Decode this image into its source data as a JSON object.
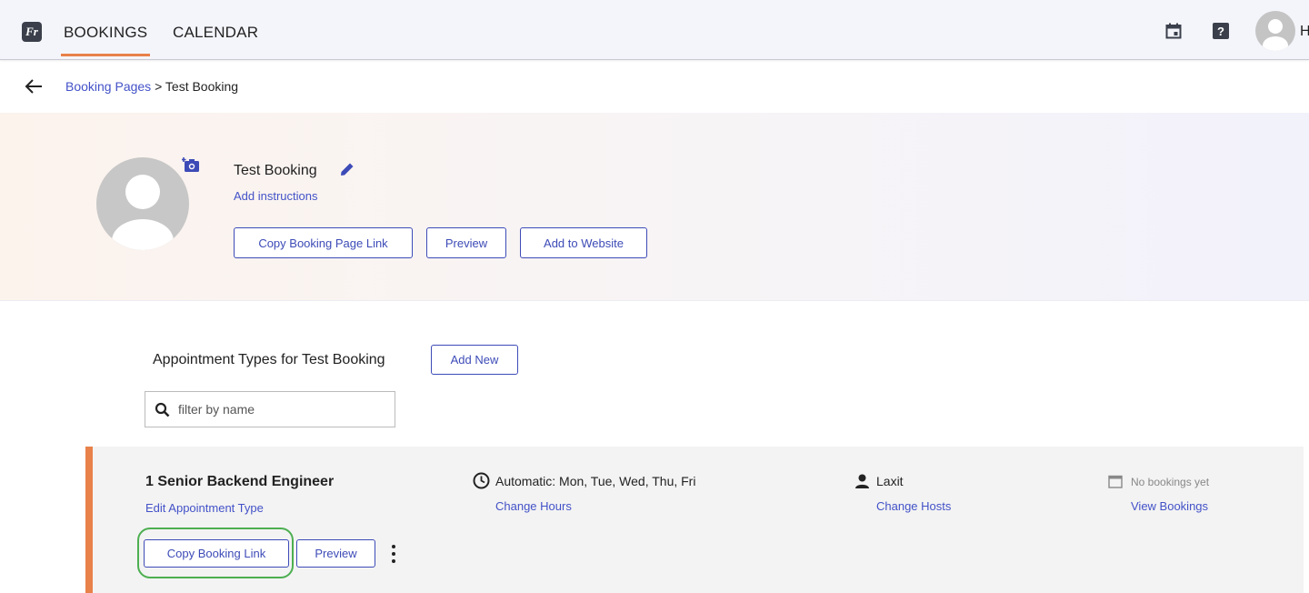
{
  "nav": {
    "logo_text": "Fr",
    "tabs": [
      {
        "label": "BOOKINGS",
        "active": true
      },
      {
        "label": "CALENDAR",
        "active": false
      }
    ],
    "help_label": "?",
    "user_initial_partial": "H"
  },
  "breadcrumb": {
    "parent": "Booking Pages",
    "separator": ">",
    "current": "Test Booking"
  },
  "page": {
    "title": "Test Booking",
    "add_instructions": "Add instructions",
    "buttons": {
      "copy_page_link": "Copy Booking Page Link",
      "preview": "Preview",
      "add_to_website": "Add to Website"
    }
  },
  "appointments": {
    "heading": "Appointment Types for Test Booking",
    "add_new": "Add New",
    "filter_placeholder": "filter by name",
    "items": [
      {
        "name": "1 Senior Backend Engineer",
        "edit_link": "Edit Appointment Type",
        "hours": "Automatic: Mon, Tue, Wed, Thu, Fri",
        "change_hours": "Change Hours",
        "host": "Laxit",
        "change_hosts": "Change Hosts",
        "bookings_status": "No bookings yet",
        "view_bookings": "View Bookings",
        "copy_link": "Copy Booking Link",
        "preview": "Preview"
      }
    ]
  },
  "colors": {
    "accent": "#e8814a",
    "link": "#4352c8",
    "highlight": "#4caf50"
  }
}
